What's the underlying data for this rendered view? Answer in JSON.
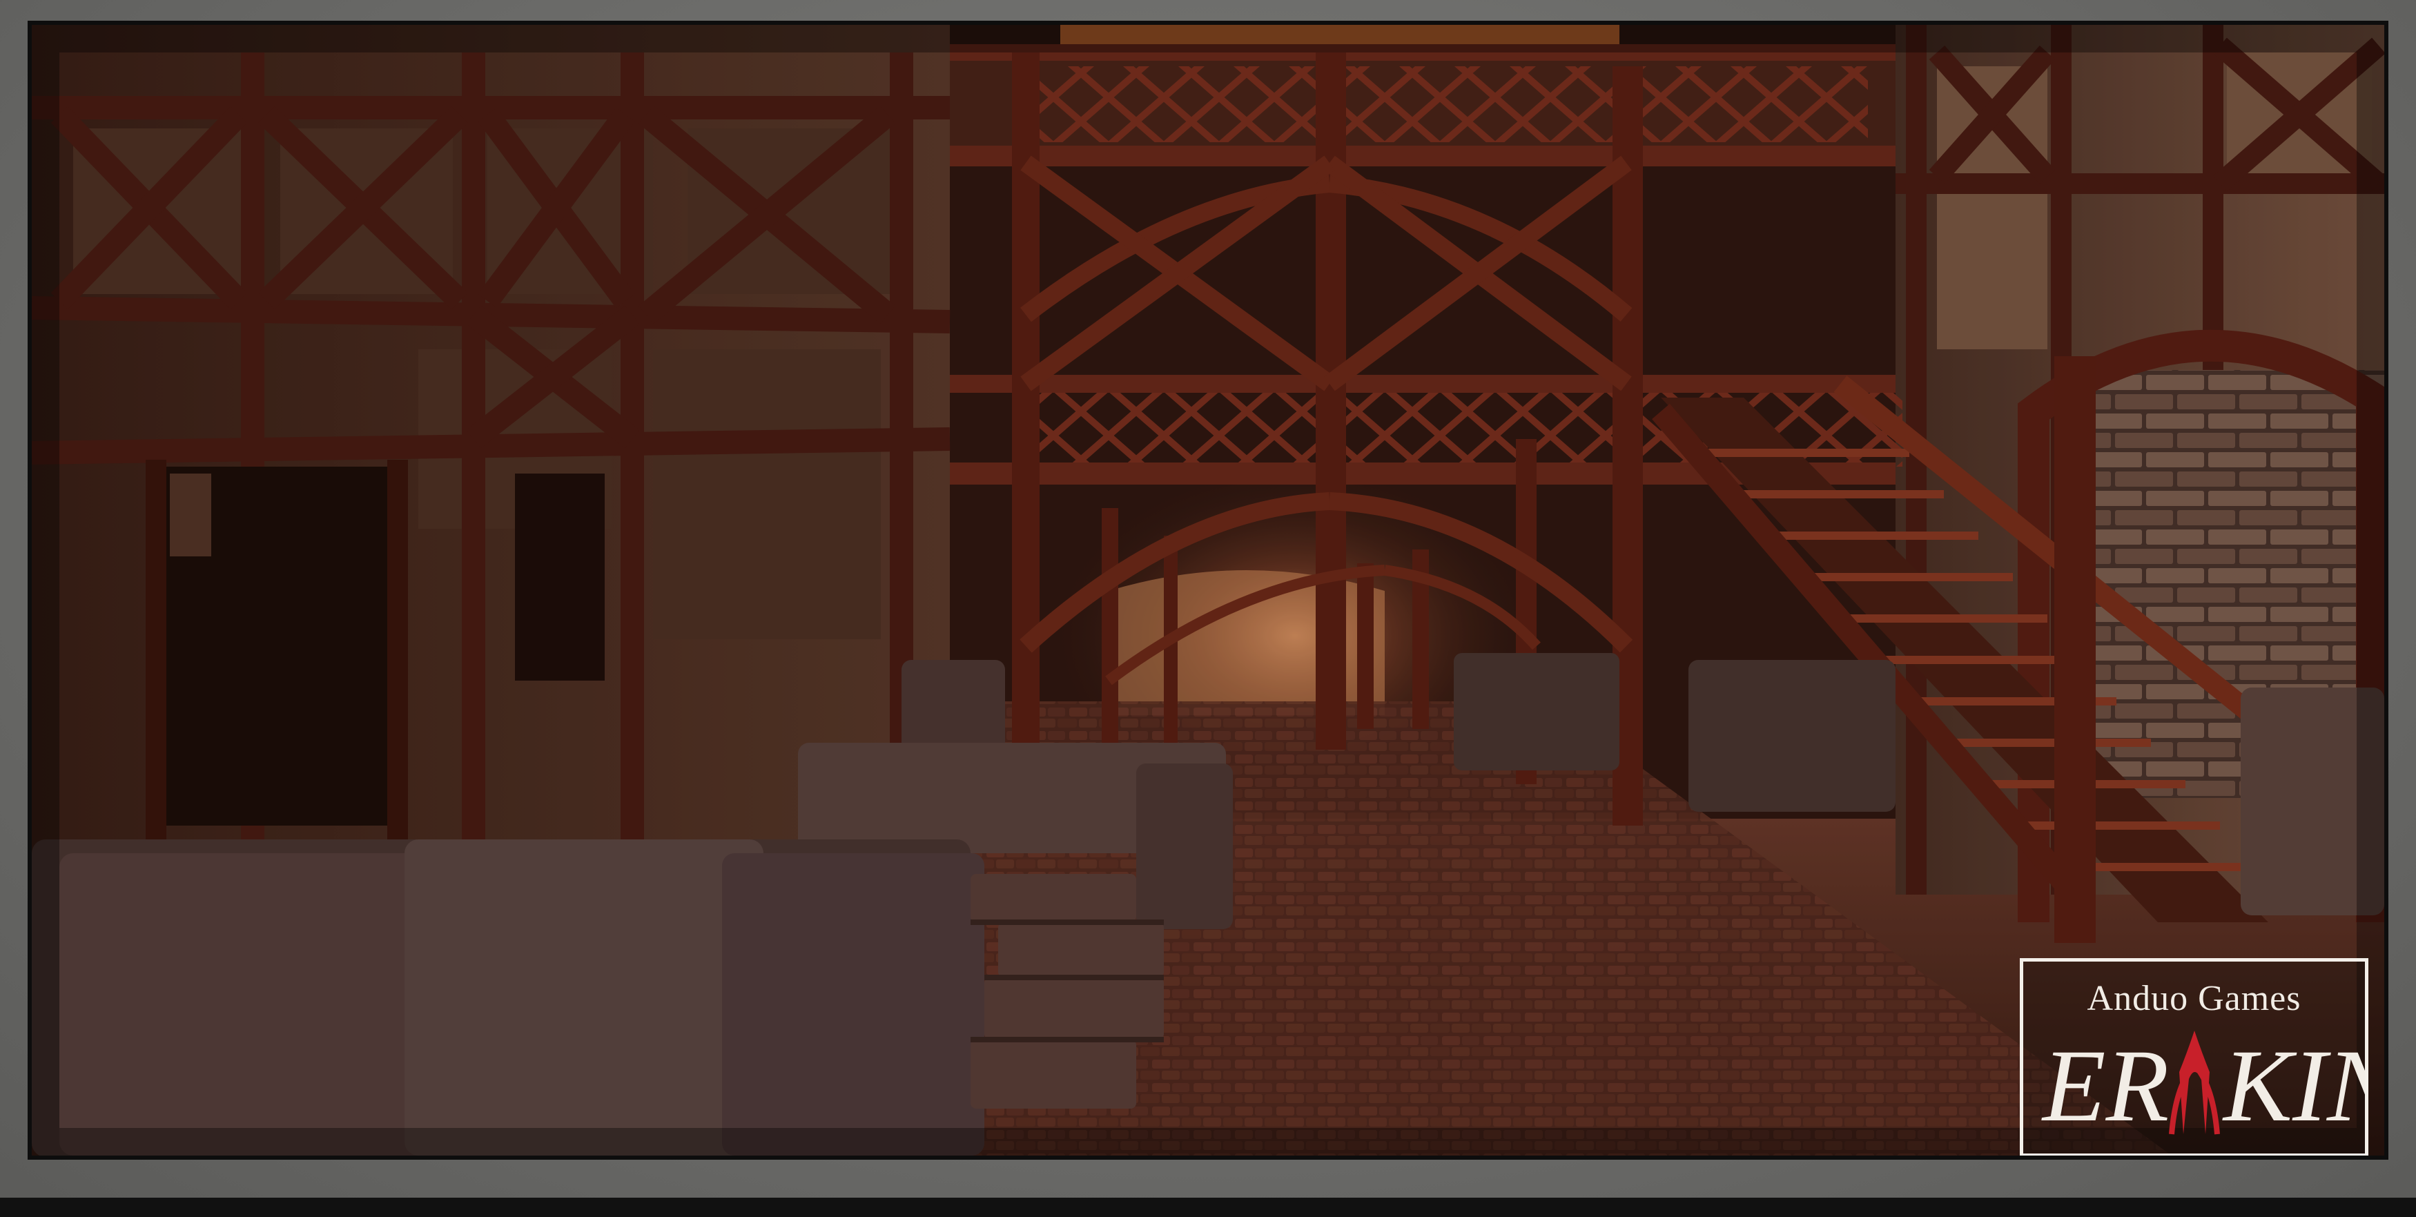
{
  "scene": {
    "description_hidden": false,
    "palette": {
      "sky": "#d9782a",
      "timber": "#5a2218",
      "plaster": "#3b2a22",
      "cobble": "#4a2a22",
      "stone": "#4a3b38",
      "highlight": "#e6a26a"
    }
  },
  "watermark": {
    "company": "Anduo Games",
    "title_left": "ER",
    "title_right": "KIN",
    "accent_color": "#c8202a",
    "text_color": "#f2ede6"
  }
}
